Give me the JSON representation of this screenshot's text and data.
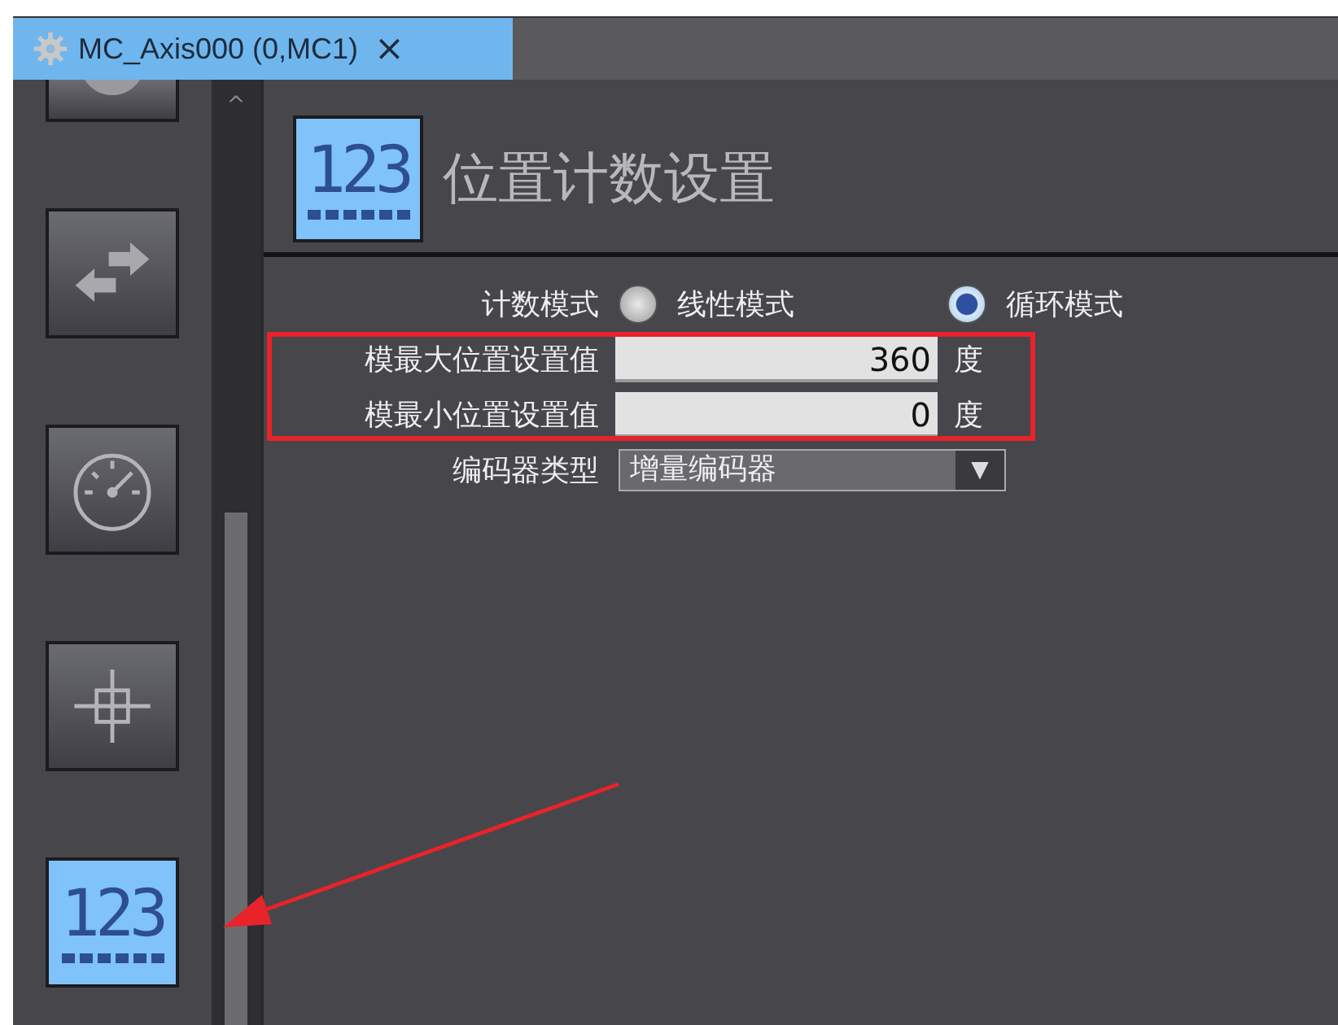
{
  "tab": {
    "title": "MC_Axis000 (0,MC1)",
    "close": "×"
  },
  "sidebar": {
    "items": [
      {
        "kind": "partial",
        "selected": false
      },
      {
        "kind": "arrows",
        "selected": false
      },
      {
        "kind": "gauge",
        "selected": false
      },
      {
        "kind": "crosshair",
        "selected": false
      },
      {
        "kind": "counter",
        "selected": true,
        "label": "123"
      }
    ],
    "scroll_up": "^"
  },
  "section": {
    "icon_label": "123",
    "title": "位置计数设置"
  },
  "count_mode": {
    "label": "计数模式",
    "options": [
      {
        "label": "线性模式",
        "selected": false
      },
      {
        "label": "循环模式",
        "selected": true
      }
    ]
  },
  "fields": [
    {
      "label": "模最大位置设置值",
      "value": "360",
      "unit": "度"
    },
    {
      "label": "模最小位置设置值",
      "value": "0",
      "unit": "度"
    }
  ],
  "encoder": {
    "label": "编码器类型",
    "value": "增量编码器",
    "arrow": "▼"
  },
  "annotations": {
    "highlight_box": true,
    "arrow": true
  }
}
